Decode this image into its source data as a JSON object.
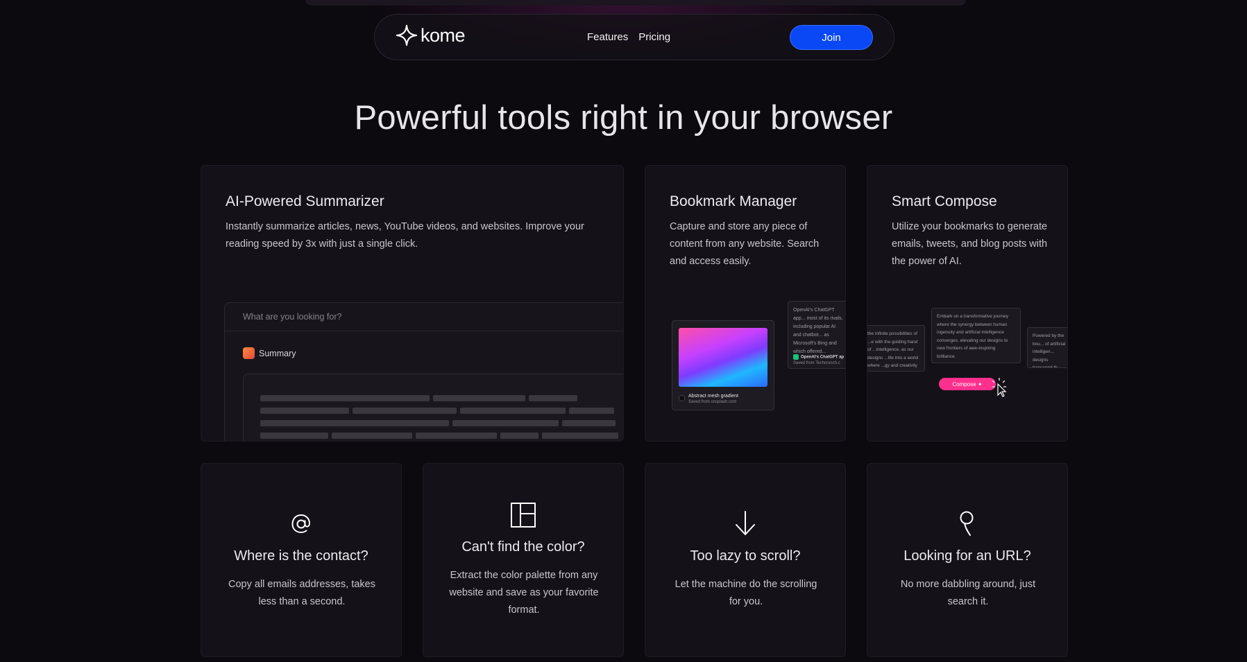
{
  "nav": {
    "logo_text": "kome",
    "links": [
      "Features",
      "Pricing"
    ],
    "join_label": "Join"
  },
  "hero": {
    "title": "Powerful tools right in your browser"
  },
  "features": [
    {
      "title": "AI-Powered Summarizer",
      "description": "Instantly summarize articles, news, YouTube videos, and websites. Improve your reading speed by 3x with just a single click.",
      "mock": {
        "search_placeholder": "What are you looking for?",
        "summary_label": "Summary"
      }
    },
    {
      "title": "Bookmark Manager",
      "description": "Capture and store any piece of content from any website. Search and access easily.",
      "mock": {
        "card_title": "Abstract mesh gradient",
        "card_source": "Saved from unsplash.com",
        "side_text": "OpenAI's ChatGPT app... most of its rivals, including popular AI and chatbot... as Microsoft's Bing and which offered...",
        "side_title": "OpenAI's ChatGPT ap",
        "side_source": "Saved from Techcrunch.c"
      }
    },
    {
      "title": "Smart Compose",
      "description": "Utilize your bookmarks to generate emails, tweets, and blog posts with the power of AI.",
      "mock": {
        "center_text": "Embark on a transformative journey where the synergy between human ingenuity and artificial intelligence converges, elevating our designs to new frontiers of awe-inspiring brilliance.",
        "left_text": "the infinite possibilities of ...e with the guiding hand of ...intelligence, as our designs ...life into a world where ...gy and creativity intertwine ...ssly.",
        "right_text": "Powered by the bou... of artificial intelligen... designs transcend th... possibility, harmoniz... and imagination in p...",
        "compose_label": "Compose"
      }
    }
  ],
  "tools": [
    {
      "icon": "at-sign-icon",
      "title": "Where is the contact?",
      "description": "Copy all emails addresses, takes less than a second."
    },
    {
      "icon": "palette-grid-icon",
      "title": "Can't find the color?",
      "description": "Extract the color palette from any website and save as your favorite format."
    },
    {
      "icon": "arrow-down-icon",
      "title": "Too lazy to scroll?",
      "description": "Let the machine do the scrolling for you."
    },
    {
      "icon": "search-pin-icon",
      "title": "Looking for an URL?",
      "description": "No more dabbling around, just search it."
    }
  ],
  "colors": {
    "accent_blue": "#0a48f6",
    "compose_pink": "#ff2f8e",
    "background": "#0c090f"
  }
}
